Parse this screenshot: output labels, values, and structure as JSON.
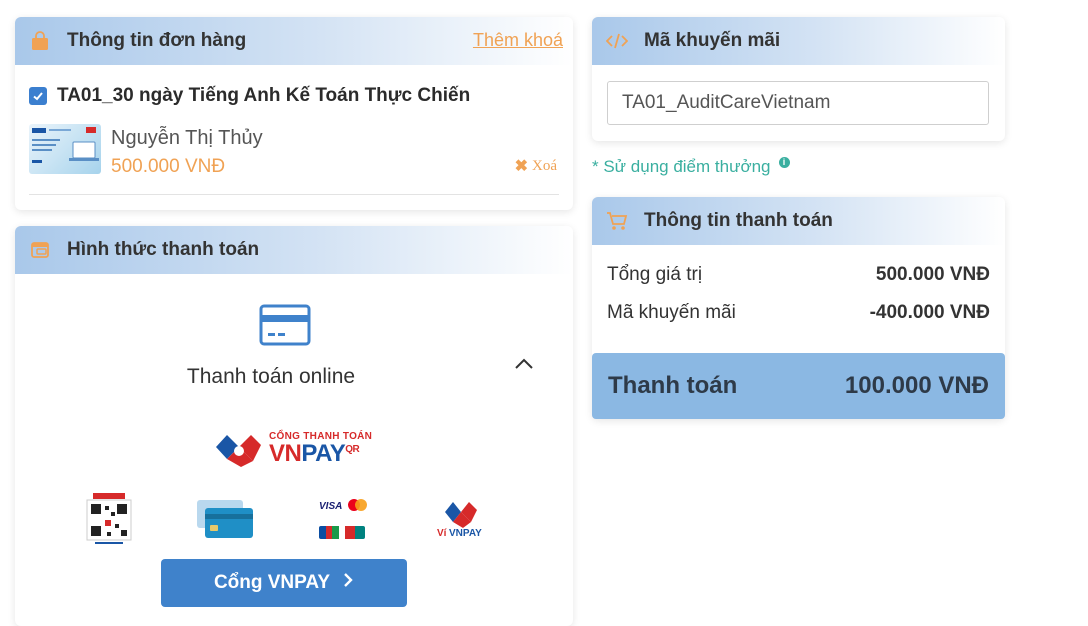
{
  "order": {
    "title": "Thông tin đơn hàng",
    "add_key_label": "Thêm khoá",
    "course_name": "TA01_30 ngày Tiếng Anh Kế Toán Thực Chiến",
    "course_checked": true,
    "teacher": "Nguyễn Thị Thủy",
    "price": "500.000 VNĐ",
    "delete_label": "Xoá"
  },
  "payment_method": {
    "title": "Hình thức thanh toán",
    "online_label": "Thanh toán online",
    "gateway_top": "CỔNG THANH TOÁN",
    "gateway_vn": "VN",
    "gateway_pay": "PAY",
    "gateway_qr": "QR",
    "options": [
      "vnpay-qr",
      "atm-card",
      "international-card",
      "vnpay-wallet"
    ],
    "button_label": "Cổng VNPAY"
  },
  "promo": {
    "title": "Mã khuyến mãi",
    "code_value": "TA01_AuditCareVietnam",
    "points_link": "* Sử dụng điểm thưởng"
  },
  "summary": {
    "title": "Thông tin thanh toán",
    "rows": [
      {
        "label": "Tổng giá trị",
        "value": "500.000 VNĐ"
      },
      {
        "label": "Mã khuyến mãi",
        "value": "-400.000 VNĐ"
      }
    ],
    "total_label": "Thanh toán",
    "total_value": "100.000 VNĐ"
  },
  "colors": {
    "accent_blue": "#3f82cb",
    "accent_orange": "#f0a254",
    "accent_teal": "#3aafa0"
  }
}
